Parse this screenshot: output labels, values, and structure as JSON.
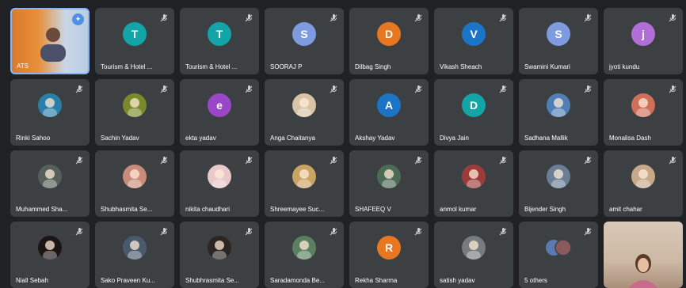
{
  "self_tile": {
    "name": "ATS",
    "bg": "#e88f3a"
  },
  "tiles": [
    {
      "name": "Tourism & Hotel ...",
      "initial": "T",
      "color": "#12a4a6",
      "kind": "letter"
    },
    {
      "name": "Tourism & Hotel ...",
      "initial": "T",
      "color": "#12a4a6",
      "kind": "letter"
    },
    {
      "name": "SOORAJ P",
      "initial": "S",
      "color": "#7e9be0",
      "kind": "letter"
    },
    {
      "name": "Dilbag Singh",
      "initial": "D",
      "color": "#e87722",
      "kind": "letter"
    },
    {
      "name": "Vikash Sheach",
      "initial": "V",
      "color": "#1b74c5",
      "kind": "letter"
    },
    {
      "name": "Swamini Kumari",
      "initial": "S",
      "color": "#7e9be0",
      "kind": "letter"
    },
    {
      "name": "jyoti kundu",
      "initial": "j",
      "color": "#b06ed6",
      "kind": "letter"
    },
    {
      "name": "Rinki Sahoo",
      "color": "#2a7fa8",
      "kind": "photo",
      "icon": "user-photo-icon"
    },
    {
      "name": "Sachin Yadav",
      "color": "#7a8a2a",
      "kind": "photo",
      "icon": "user-photo-icon"
    },
    {
      "name": "ekta yadav",
      "initial": "e",
      "color": "#9a47c7",
      "kind": "letter"
    },
    {
      "name": "Anga Chaitanya",
      "color": "#d9c3a7",
      "kind": "photo",
      "icon": "user-photo-icon"
    },
    {
      "name": "Akshay Yadav",
      "initial": "A",
      "color": "#1b74c5",
      "kind": "letter"
    },
    {
      "name": "Divya Jain",
      "initial": "D",
      "color": "#12a4a6",
      "kind": "letter"
    },
    {
      "name": "Sadhana Mallik",
      "color": "#4f7fb5",
      "kind": "photo",
      "icon": "user-photo-icon"
    },
    {
      "name": "Monalisa Dash",
      "color": "#cf6f5a",
      "kind": "photo",
      "icon": "user-photo-icon"
    },
    {
      "name": "Muhammed Sha...",
      "color": "#56605a",
      "kind": "photo",
      "icon": "user-photo-icon"
    },
    {
      "name": "Shubhasmita Se...",
      "color": "#c98c7a",
      "kind": "photo",
      "icon": "user-photo-icon"
    },
    {
      "name": "nikita chaudhari",
      "color": "#e8c8c8",
      "kind": "photo",
      "icon": "user-photo-icon"
    },
    {
      "name": "Shreemayee Suc...",
      "color": "#c9a463",
      "kind": "photo",
      "icon": "user-photo-icon"
    },
    {
      "name": "SHAFEEQ V",
      "color": "#4c6a54",
      "kind": "photo",
      "icon": "user-photo-icon"
    },
    {
      "name": "anmol kumar",
      "color": "#9c3b3b",
      "kind": "photo",
      "icon": "user-photo-icon"
    },
    {
      "name": "Bijender Singh",
      "color": "#6a7f96",
      "kind": "photo",
      "icon": "user-photo-icon"
    },
    {
      "name": "amit chahar",
      "color": "#c7a98a",
      "kind": "photo",
      "icon": "user-photo-icon"
    },
    {
      "name": "Niall Sebah",
      "color": "#1c1415",
      "kind": "photo",
      "icon": "user-photo-icon"
    },
    {
      "name": "Sako Praveen Ku...",
      "color": "#4a5a6e",
      "kind": "photo",
      "icon": "user-photo-icon"
    },
    {
      "name": "Shubhrasmita Se...",
      "color": "#2d2522",
      "kind": "photo",
      "icon": "user-photo-icon"
    },
    {
      "name": "Saradamonda Be...",
      "color": "#5a8060",
      "kind": "photo",
      "icon": "user-photo-icon"
    },
    {
      "name": "Rekha Sharma",
      "initial": "R",
      "color": "#e87722",
      "kind": "letter"
    },
    {
      "name": "satish yadav",
      "color": "#767b80",
      "kind": "photo",
      "icon": "user-photo-icon"
    },
    {
      "name": "5 others",
      "kind": "others"
    }
  ],
  "video_tile": {
    "kind": "camera-feed"
  }
}
